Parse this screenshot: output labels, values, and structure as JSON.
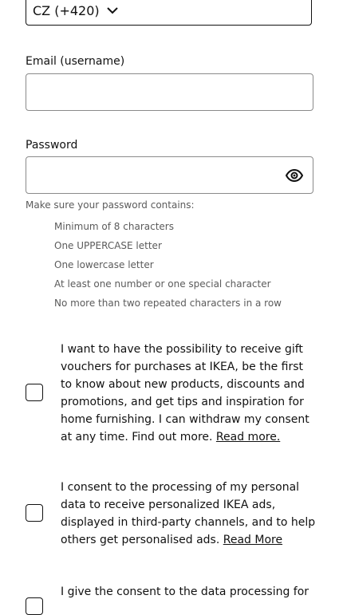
{
  "country": {
    "value": "CZ (+420)",
    "icon": "chevron-down-icon"
  },
  "email": {
    "label": "Email (username)",
    "value": ""
  },
  "password": {
    "label": "Password",
    "value": "",
    "icon": "eye-icon",
    "hint": "Make sure your password contains:",
    "requirements": [
      "Minimum of 8 characters",
      "One UPPERCASE letter",
      "One lowercase letter",
      "At least one number or one special character",
      "No more than two repeated characters in a row"
    ]
  },
  "consents": [
    {
      "text": "I want to have the possibility to receive gift vouchers for purchases at IKEA, be the first to know about new products, discounts and promotions, and get tips and inspiration for home furnishing. I can withdraw my consent at any time. Find out more. ",
      "link": "Read more."
    },
    {
      "text": "I consent to the processing of my personal data to receive personalized IKEA ads, displayed in third-party channels, and to help others get personalised ads. ",
      "link": "Read More"
    },
    {
      "text": "I give the consent to the data processing for",
      "link": ""
    }
  ]
}
